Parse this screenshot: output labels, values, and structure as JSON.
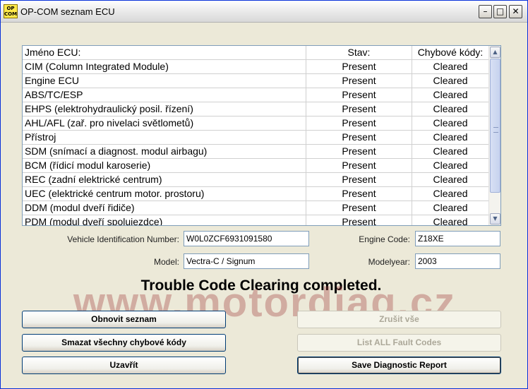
{
  "window": {
    "title": "OP-COM seznam ECU",
    "icon_text_top": "OP",
    "icon_text_bottom": "COM",
    "minimize_glyph": "–",
    "maximize_glyph": "□",
    "close_glyph": "✕"
  },
  "ecu_table": {
    "headers": [
      "Jméno ECU:",
      "Stav:",
      "Chybové kódy:"
    ],
    "rows": [
      [
        "CIM (Column Integrated Module)",
        "Present",
        "Cleared"
      ],
      [
        "Engine ECU",
        "Present",
        "Cleared"
      ],
      [
        "ABS/TC/ESP",
        "Present",
        "Cleared"
      ],
      [
        "EHPS (elektrohydraulický posil. řízení)",
        "Present",
        "Cleared"
      ],
      [
        "AHL/AFL (zař. pro nivelaci světlometů)",
        "Present",
        "Cleared"
      ],
      [
        "Přístroj",
        "Present",
        "Cleared"
      ],
      [
        "SDM (snímací a diagnost. modul airbagu)",
        "Present",
        "Cleared"
      ],
      [
        "BCM (řídicí modul karoserie)",
        "Present",
        "Cleared"
      ],
      [
        "REC (zadní elektrické centrum)",
        "Present",
        "Cleared"
      ],
      [
        "UEC (elektrické centrum motor. prostoru)",
        "Present",
        "Cleared"
      ],
      [
        "DDM (modul dveří řidiče)",
        "Present",
        "Cleared"
      ],
      [
        "PDM (modul dveří spolujezdce)",
        "Present",
        "Cleared"
      ]
    ]
  },
  "vehicle": {
    "vin_label": "Vehicle Identification Number:",
    "vin_value": "W0L0ZCF6931091580",
    "engine_code_label": "Engine Code:",
    "engine_code_value": "Z18XE",
    "model_label": "Model:",
    "model_value": "Vectra-C / Signum",
    "modelyear_label": "Modelyear:",
    "modelyear_value": "2003"
  },
  "status_message": "Trouble Code Clearing completed.",
  "watermark": "www.motordiag.cz",
  "buttons": {
    "refresh": "Obnovit seznam",
    "clear_all": "Smazat všechny chybové kódy",
    "close": "Uzavřít",
    "cancel": "Zrušit vše",
    "list_all": "List ALL Fault Codes",
    "save_report": "Save Diagnostic Report"
  },
  "colors": {
    "window_bg": "#ECE9D8",
    "watermark": "#A03C3C",
    "disabled_text": "#ACA899"
  }
}
